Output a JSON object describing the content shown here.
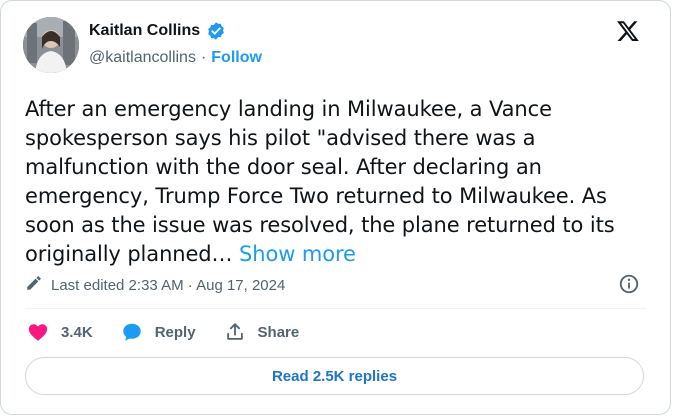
{
  "author": {
    "name": "Kaitlan Collins",
    "handle": "@kaitlancollins",
    "separator": "·",
    "follow_label": "Follow",
    "verified_icon": "verified-badge-icon"
  },
  "tweet": {
    "text": "After an emergency landing in Milwaukee, a Vance spokesperson says his pilot \"advised there was a malfunction with the door seal. After declaring an emergency, Trump Force Two returned to Milwaukee. As soon as the issue was resolved, the plane returned to its originally planned…",
    "show_more_label": "Show more"
  },
  "meta": {
    "edited_text": "Last edited 2:33 AM · Aug 17, 2024"
  },
  "actions": {
    "likes": "3.4K",
    "reply_label": "Reply",
    "share_label": "Share"
  },
  "replies_button_label": "Read 2.5K replies",
  "colors": {
    "accent": "#1d9bf0",
    "like": "#f91880",
    "text": "#0f1419",
    "muted": "#536471"
  }
}
